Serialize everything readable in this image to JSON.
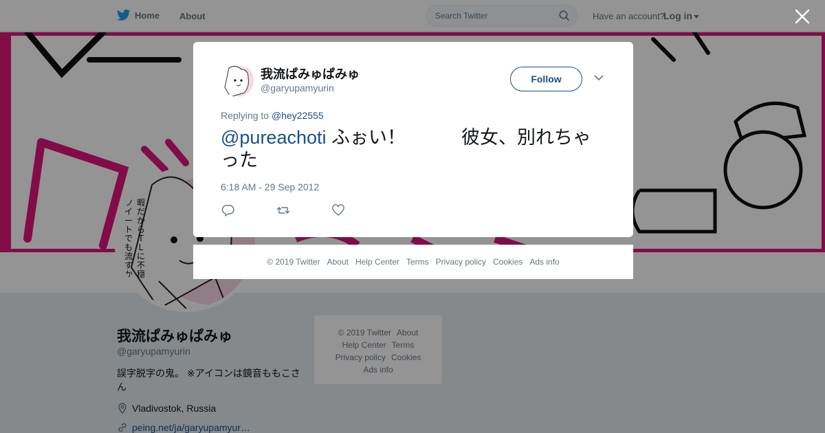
{
  "topbar": {
    "home_label": "Home",
    "about_label": "About",
    "search_placeholder": "Search Twitter",
    "have_account_text": "Have an account?",
    "login_label": "Log in"
  },
  "profile": {
    "name": "我流ぱみゅぱみゅ",
    "handle": "@garyupamyurin",
    "bio": "誤字脱字の鬼。 ※アイコンは鏡音ももこさん",
    "location": "Vladivostok, Russia",
    "url": "peing.net/ja/garyupamyur…",
    "avatar_caption": [
      "暇",
      "だ",
      "か",
      "ら",
      "T",
      "L",
      "に",
      "不",
      "穏",
      "ツ",
      "イ",
      "ー",
      "ト",
      "で",
      "も",
      "流",
      "す",
      "か"
    ]
  },
  "side_footer": {
    "row1": [
      "© 2019 Twitter",
      "About"
    ],
    "row2": [
      "Help Center",
      "Terms"
    ],
    "row3": [
      "Privacy policy",
      "Cookies"
    ],
    "row4": [
      "Ads info"
    ]
  },
  "modal": {
    "name": "我流ぱみゅぱみゅ",
    "handle": "@garyupamyurin",
    "follow_label": "Follow",
    "replying_prefix": "Replying to",
    "replying_to": "@hey22555",
    "mention": "@pureachoti",
    "tweet_body": " ふぉい！　　　彼女、別れちゃった",
    "timestamp": "6:18 AM - 29 Sep 2012"
  },
  "modal_footer": {
    "links": [
      "© 2019 Twitter",
      "About",
      "Help Center",
      "Terms",
      "Privacy policy",
      "Cookies",
      "Ads info"
    ]
  },
  "colors": {
    "link": "#1b4f8a",
    "muted": "#657786",
    "text": "#14171a",
    "twitter_blue": "#1da1f2",
    "banner_pink": "#e0157a"
  },
  "icons": {
    "logo": "twitter-bird-icon",
    "search": "search-icon",
    "close": "close-icon",
    "chevron": "chevron-down-icon",
    "reply": "reply-icon",
    "retweet": "retweet-icon",
    "like": "heart-icon",
    "location": "location-pin-icon",
    "link": "link-icon"
  }
}
